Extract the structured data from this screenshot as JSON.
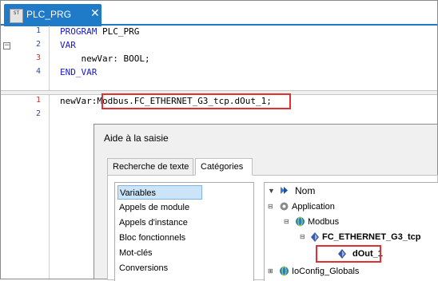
{
  "tab": {
    "icon_text": "ST",
    "label": "PLC_PRG",
    "close": "✕"
  },
  "declaration": {
    "lines": [
      {
        "num": "1",
        "kw": "PROGRAM",
        "rest": " PLC_PRG"
      },
      {
        "num": "2",
        "kw": "VAR",
        "rest": ""
      },
      {
        "num": "3",
        "kw": "",
        "rest": "    newVar: BOOL;"
      },
      {
        "num": "4",
        "kw": "END_VAR",
        "rest": ""
      }
    ]
  },
  "implementation": {
    "lines": [
      {
        "num": "1",
        "prefix": "newVar:",
        "highlight": "Modbus.FC_ETHERNET_G3_tcp.dOut_1;"
      },
      {
        "num": "2",
        "prefix": "",
        "highlight": ""
      }
    ]
  },
  "dialog": {
    "title": "Aide à la saisie",
    "tabs": [
      "Recherche de texte :",
      "Catégories"
    ],
    "active_tab": "Catégories",
    "categories": [
      "Variables",
      "Appels de module",
      "Appels d'instance",
      "Bloc fonctionnels",
      "Mot-clés",
      "Conversions"
    ],
    "selected_category": "Variables",
    "tree": {
      "header": "Nom",
      "nodes": [
        "Application",
        "Modbus",
        "FC_ETHERNET_G3_tcp",
        "dOut_1",
        "IoConfig_Globals"
      ]
    }
  },
  "colors": {
    "accent": "#1f7ac8",
    "keyword": "#1a1ac8",
    "highlight_box": "#e03030",
    "selection": "#cce4f7"
  }
}
